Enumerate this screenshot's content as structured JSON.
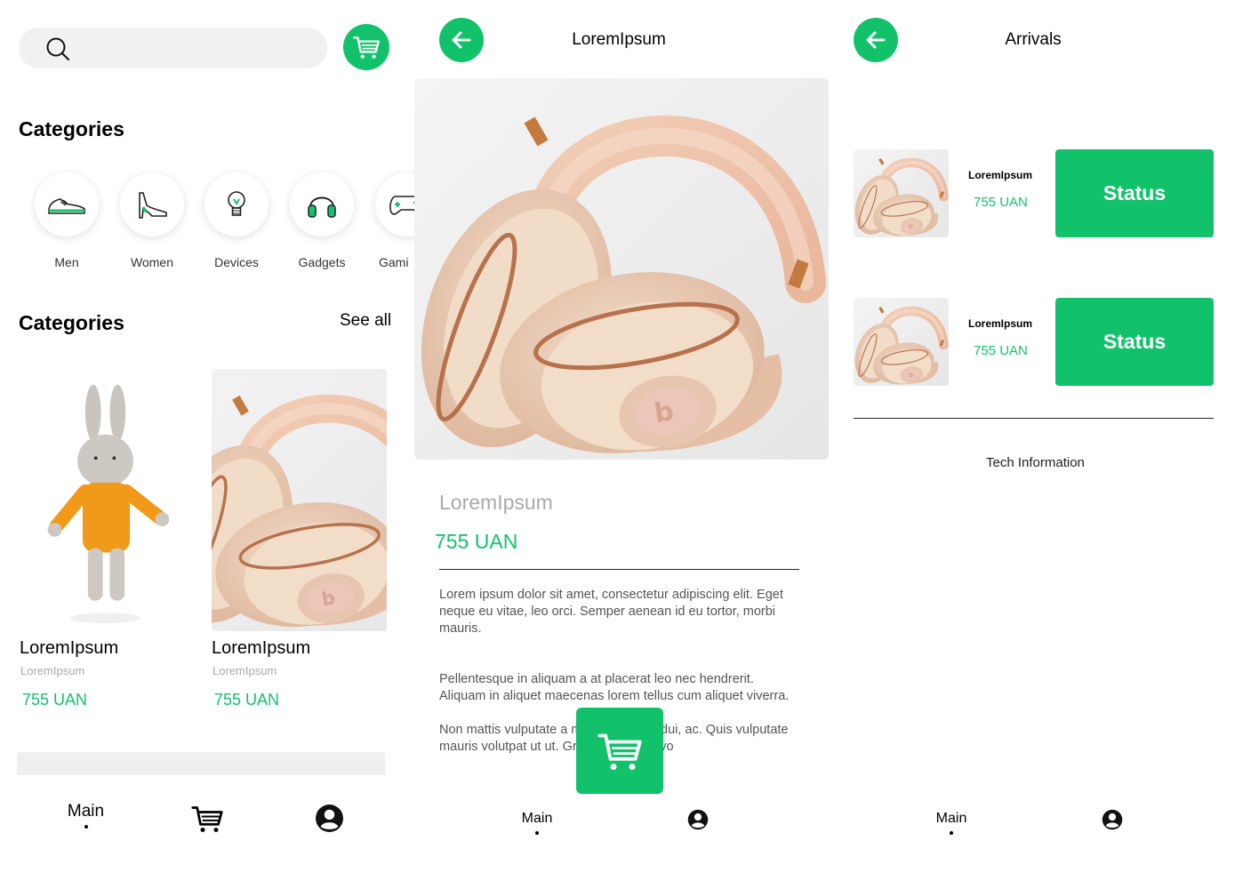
{
  "colors": {
    "accent": "#12c26b",
    "muted": "#aaaaaa",
    "searchbar": "#f1f1f1"
  },
  "home": {
    "search": {
      "placeholder": "",
      "icon": "search-icon"
    },
    "cart_icon": "cart-icon",
    "categories_title": "Categories",
    "categories": [
      {
        "label": "Men",
        "icon": "sneaker-icon"
      },
      {
        "label": "Women",
        "icon": "high-heel-icon"
      },
      {
        "label": "Devices",
        "icon": "lightbulb-icon"
      },
      {
        "label": "Gadgets",
        "icon": "headphones-icon"
      },
      {
        "label": "Gami",
        "icon": "gamepad-icon"
      }
    ],
    "section_title": "Categories",
    "see_all": "See all",
    "products": [
      {
        "title": "LoremIpsum",
        "subtitle": "LoremIpsum",
        "price": "755 UAN",
        "image": "bunny-toy"
      },
      {
        "title": "LoremIpsum",
        "subtitle": "LoremIpsum",
        "price": "755 UAN",
        "image": "headphones"
      }
    ],
    "nav": {
      "main": "Main",
      "cart_icon": "cart-icon",
      "profile_icon": "profile-icon"
    }
  },
  "product": {
    "title": "LoremIpsum",
    "name": "LoremIpsum",
    "price": "755 UAN",
    "paragraphs": [
      "Lorem ipsum dolor sit amet, consectetur adipiscing elit. Eget neque eu vitae, leo orci. Semper aenean id eu tortor, morbi mauris.",
      "Pellentesque in aliquam a at placerat leo nec hendrerit. Aliquam in aliquet maecenas lorem tellus cum aliquet viverra.",
      "Non mattis vulputate a mauris sagittis, dui, ac. Quis vulputate mauris volutpat ut ut. Gravida volutpat vo"
    ],
    "nav": {
      "main": "Main",
      "profile_icon": "profile-icon"
    }
  },
  "arrivals": {
    "title": "Arrivals",
    "items": [
      {
        "name": "LoremIpsum",
        "price": "755 UAN",
        "status": "Status"
      },
      {
        "name": "LoremIpsum",
        "price": "755 UAN",
        "status": "Status"
      }
    ],
    "tech_info": "Tech Information",
    "nav": {
      "main": "Main",
      "profile_icon": "profile-icon"
    }
  }
}
